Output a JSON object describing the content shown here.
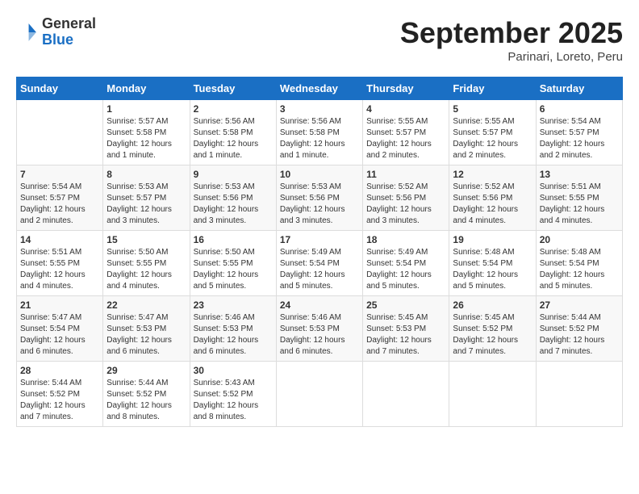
{
  "header": {
    "logo_general": "General",
    "logo_blue": "Blue",
    "month_title": "September 2025",
    "subtitle": "Parinari, Loreto, Peru"
  },
  "days_of_week": [
    "Sunday",
    "Monday",
    "Tuesday",
    "Wednesday",
    "Thursday",
    "Friday",
    "Saturday"
  ],
  "weeks": [
    [
      {
        "day": "",
        "info": ""
      },
      {
        "day": "1",
        "info": "Sunrise: 5:57 AM\nSunset: 5:58 PM\nDaylight: 12 hours\nand 1 minute."
      },
      {
        "day": "2",
        "info": "Sunrise: 5:56 AM\nSunset: 5:58 PM\nDaylight: 12 hours\nand 1 minute."
      },
      {
        "day": "3",
        "info": "Sunrise: 5:56 AM\nSunset: 5:58 PM\nDaylight: 12 hours\nand 1 minute."
      },
      {
        "day": "4",
        "info": "Sunrise: 5:55 AM\nSunset: 5:57 PM\nDaylight: 12 hours\nand 2 minutes."
      },
      {
        "day": "5",
        "info": "Sunrise: 5:55 AM\nSunset: 5:57 PM\nDaylight: 12 hours\nand 2 minutes."
      },
      {
        "day": "6",
        "info": "Sunrise: 5:54 AM\nSunset: 5:57 PM\nDaylight: 12 hours\nand 2 minutes."
      }
    ],
    [
      {
        "day": "7",
        "info": "Sunrise: 5:54 AM\nSunset: 5:57 PM\nDaylight: 12 hours\nand 2 minutes."
      },
      {
        "day": "8",
        "info": "Sunrise: 5:53 AM\nSunset: 5:57 PM\nDaylight: 12 hours\nand 3 minutes."
      },
      {
        "day": "9",
        "info": "Sunrise: 5:53 AM\nSunset: 5:56 PM\nDaylight: 12 hours\nand 3 minutes."
      },
      {
        "day": "10",
        "info": "Sunrise: 5:53 AM\nSunset: 5:56 PM\nDaylight: 12 hours\nand 3 minutes."
      },
      {
        "day": "11",
        "info": "Sunrise: 5:52 AM\nSunset: 5:56 PM\nDaylight: 12 hours\nand 3 minutes."
      },
      {
        "day": "12",
        "info": "Sunrise: 5:52 AM\nSunset: 5:56 PM\nDaylight: 12 hours\nand 4 minutes."
      },
      {
        "day": "13",
        "info": "Sunrise: 5:51 AM\nSunset: 5:55 PM\nDaylight: 12 hours\nand 4 minutes."
      }
    ],
    [
      {
        "day": "14",
        "info": "Sunrise: 5:51 AM\nSunset: 5:55 PM\nDaylight: 12 hours\nand 4 minutes."
      },
      {
        "day": "15",
        "info": "Sunrise: 5:50 AM\nSunset: 5:55 PM\nDaylight: 12 hours\nand 4 minutes."
      },
      {
        "day": "16",
        "info": "Sunrise: 5:50 AM\nSunset: 5:55 PM\nDaylight: 12 hours\nand 5 minutes."
      },
      {
        "day": "17",
        "info": "Sunrise: 5:49 AM\nSunset: 5:54 PM\nDaylight: 12 hours\nand 5 minutes."
      },
      {
        "day": "18",
        "info": "Sunrise: 5:49 AM\nSunset: 5:54 PM\nDaylight: 12 hours\nand 5 minutes."
      },
      {
        "day": "19",
        "info": "Sunrise: 5:48 AM\nSunset: 5:54 PM\nDaylight: 12 hours\nand 5 minutes."
      },
      {
        "day": "20",
        "info": "Sunrise: 5:48 AM\nSunset: 5:54 PM\nDaylight: 12 hours\nand 5 minutes."
      }
    ],
    [
      {
        "day": "21",
        "info": "Sunrise: 5:47 AM\nSunset: 5:54 PM\nDaylight: 12 hours\nand 6 minutes."
      },
      {
        "day": "22",
        "info": "Sunrise: 5:47 AM\nSunset: 5:53 PM\nDaylight: 12 hours\nand 6 minutes."
      },
      {
        "day": "23",
        "info": "Sunrise: 5:46 AM\nSunset: 5:53 PM\nDaylight: 12 hours\nand 6 minutes."
      },
      {
        "day": "24",
        "info": "Sunrise: 5:46 AM\nSunset: 5:53 PM\nDaylight: 12 hours\nand 6 minutes."
      },
      {
        "day": "25",
        "info": "Sunrise: 5:45 AM\nSunset: 5:53 PM\nDaylight: 12 hours\nand 7 minutes."
      },
      {
        "day": "26",
        "info": "Sunrise: 5:45 AM\nSunset: 5:52 PM\nDaylight: 12 hours\nand 7 minutes."
      },
      {
        "day": "27",
        "info": "Sunrise: 5:44 AM\nSunset: 5:52 PM\nDaylight: 12 hours\nand 7 minutes."
      }
    ],
    [
      {
        "day": "28",
        "info": "Sunrise: 5:44 AM\nSunset: 5:52 PM\nDaylight: 12 hours\nand 7 minutes."
      },
      {
        "day": "29",
        "info": "Sunrise: 5:44 AM\nSunset: 5:52 PM\nDaylight: 12 hours\nand 8 minutes."
      },
      {
        "day": "30",
        "info": "Sunrise: 5:43 AM\nSunset: 5:52 PM\nDaylight: 12 hours\nand 8 minutes."
      },
      {
        "day": "",
        "info": ""
      },
      {
        "day": "",
        "info": ""
      },
      {
        "day": "",
        "info": ""
      },
      {
        "day": "",
        "info": ""
      }
    ]
  ]
}
